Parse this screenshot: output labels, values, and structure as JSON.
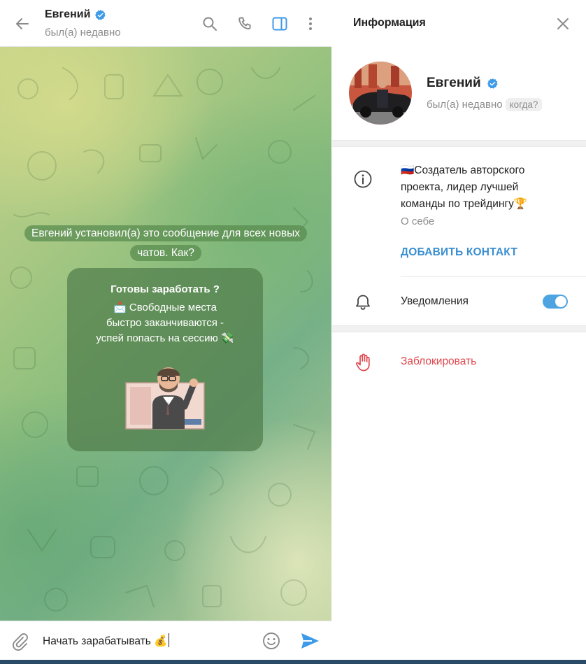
{
  "chat": {
    "name": "Евгений",
    "status": "был(а) недавно",
    "service_message": "Евгений установил(а) это сообщение для всех новых чатов. Как?",
    "intro": {
      "title": "Готовы заработать ?",
      "text": "📩 Свободные места\nбыстро заканчиваются -\nуспей попасть на сессию 💸"
    },
    "composer_text": "Начать зарабатывать 💰"
  },
  "info": {
    "title": "Информация",
    "name": "Евгений",
    "status": "был(а) недавно",
    "when_chip": "когда?",
    "bio": "🇷🇺Создатель авторского проекта, лидер лучшей команды по трейдингу🏆",
    "bio_label": "О себе",
    "add_contact": "ДОБАВИТЬ КОНТАКТ",
    "notifications_label": "Уведомления",
    "notifications_on": true,
    "block_label": "Заблокировать"
  },
  "icons": {
    "back": "arrow-left-icon",
    "search": "search-icon",
    "call": "phone-icon",
    "sidebar": "sidebar-panel-icon",
    "more": "more-vertical-icon",
    "close": "close-icon",
    "info": "info-circle-icon",
    "bell": "bell-icon",
    "block": "hand-stop-icon",
    "attach": "paperclip-icon",
    "emoji": "smile-icon",
    "send": "send-icon",
    "verified": "verified-badge-icon"
  },
  "colors": {
    "accent": "#3a8fd0",
    "verified": "#3d9ae8",
    "danger": "#e0484e",
    "toggle": "#4ea4e0"
  }
}
